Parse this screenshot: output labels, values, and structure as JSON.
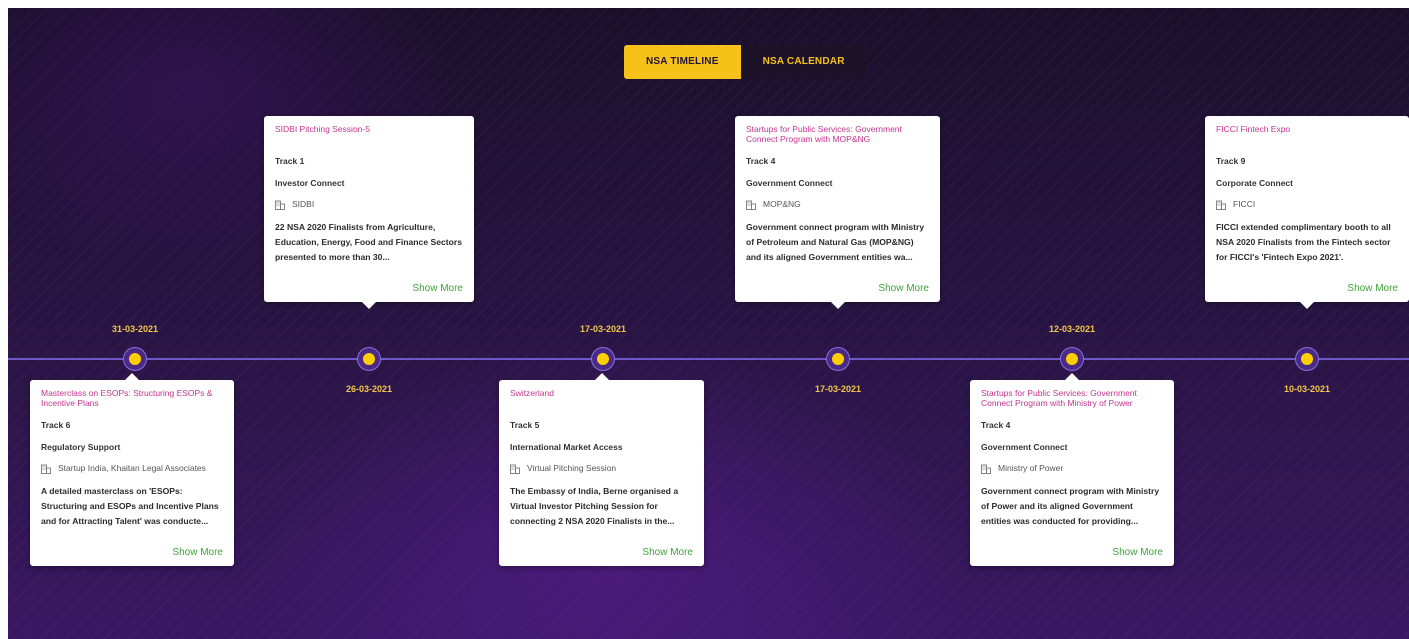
{
  "tabs": {
    "timeline": "NSA TIMELINE",
    "calendar": "NSA CALENDAR"
  },
  "colors": {
    "accent": "#f6c21a",
    "title_pink": "#c3348e",
    "show_more_green": "#3fa33c",
    "axis_purple": "#6f58c9"
  },
  "events": [
    {
      "date": "31-03-2021",
      "title": "Masterclass on ESOPs: Structuring ESOPs & Incentive Plans",
      "track": "Track 6",
      "category": "Regulatory Support",
      "organization": "Startup India, Khaitan Legal Associates",
      "description": "A detailed masterclass on 'ESOPs: Structuring and ESOPs and Incentive Plans and for Attracting Talent' was conducte...",
      "more": "Show More"
    },
    {
      "date": "26-03-2021",
      "title": "SIDBI Pitching Session-5",
      "track": "Track 1",
      "category": "Investor Connect",
      "organization": "SIDBI",
      "description": "22 NSA 2020 Finalists from Agriculture, Education, Energy, Food and Finance Sectors presented to more than 30...",
      "more": "Show More"
    },
    {
      "date": "17-03-2021",
      "title": "Switzerland",
      "track": "Track 5",
      "category": "International Market Access",
      "organization": "Virtual Pitching Session",
      "description": "The Embassy of India, Berne organised a Virtual Investor Pitching Session for connecting 2 NSA 2020 Finalists in the...",
      "more": "Show More"
    },
    {
      "date": "17-03-2021",
      "title": "Startups for Public Services: Government Connect Program with MOP&NG",
      "track": "Track 4",
      "category": "Government Connect",
      "organization": "MOP&NG",
      "description": "Government connect program with Ministry of Petroleum and Natural Gas (MOP&NG) and its aligned Government entities wa...",
      "more": "Show More"
    },
    {
      "date": "12-03-2021",
      "title": "Startups for Public Services: Government Connect Program with Ministry of Power",
      "track": "Track 4",
      "category": "Government Connect",
      "organization": "Ministry of Power",
      "description": "Government connect program with Ministry of Power and its aligned Government entities was conducted for providing...",
      "more": "Show More"
    },
    {
      "date": "10-03-2021",
      "title": "FICCI Fintech Expo",
      "track": "Track 9",
      "category": "Corporate Connect",
      "organization": "FICCI",
      "description": "FICCI extended complimentary booth to all NSA 2020 Finalists from the Fintech sector for FICCI's 'Fintech Expo 2021'.",
      "more": "Show More"
    }
  ]
}
